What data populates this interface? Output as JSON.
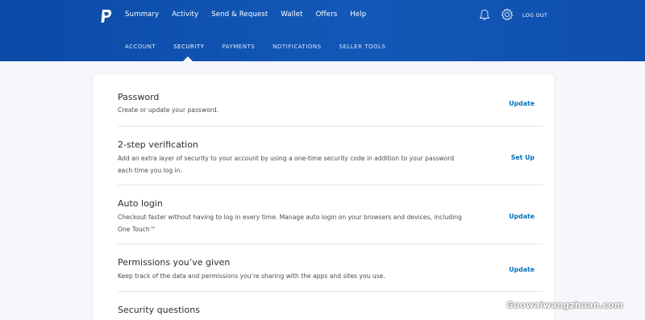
{
  "header": {
    "nav": [
      "Summary",
      "Activity",
      "Send & Request",
      "Wallet",
      "Offers",
      "Help"
    ],
    "logout_label": "LOG OUT",
    "brand_color": "#0b4aa6"
  },
  "subnav": {
    "items": [
      "ACCOUNT",
      "SECURITY",
      "PAYMENTS",
      "NOTIFICATIONS",
      "SELLER TOOLS"
    ],
    "active": "SECURITY"
  },
  "security": {
    "rows": [
      {
        "title": "Password",
        "desc": "Create or update your password.",
        "action": "Update"
      },
      {
        "title": "2-step verification",
        "desc": "Add an extra layer of security to your account by using a one-time security code in addition to your password each time you log in.",
        "action": "Set Up"
      },
      {
        "title": "Auto login",
        "desc": "Checkout faster without having to log in every time. Manage auto login on your browsers and devices, including One Touch™",
        "action": "Update"
      },
      {
        "title": "Permissions you’ve given",
        "desc": "Keep track of the data and permissions you’re sharing with the apps and sites you use.",
        "action": "Update"
      },
      {
        "title": "Security questions",
        "desc": "",
        "action": ""
      }
    ]
  },
  "watermark": "Guowaiwangzhuan.com",
  "colors": {
    "link": "#0070ba",
    "divider": "#e4e6e8"
  }
}
